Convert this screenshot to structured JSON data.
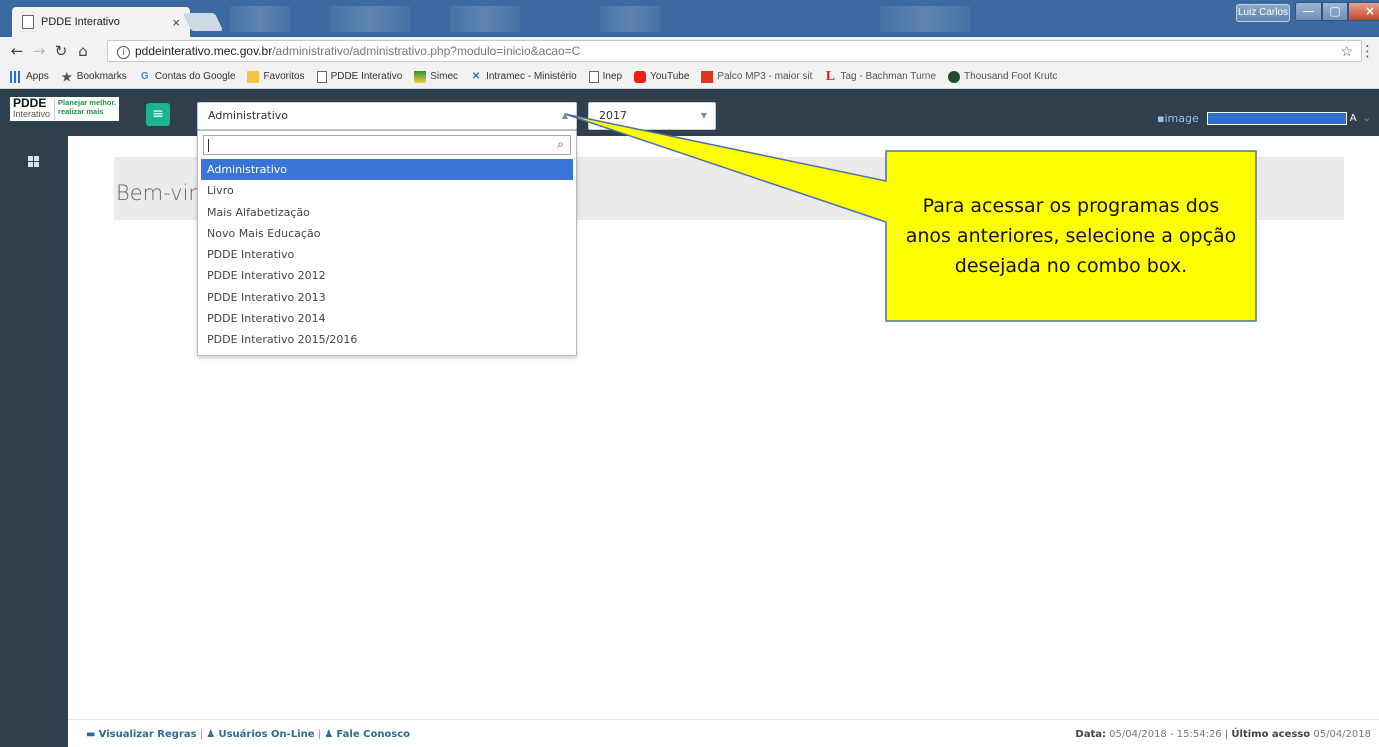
{
  "browser": {
    "tab_title": "PDDE Interativo",
    "tab_close": "×",
    "window_user": "Luiz Carlos",
    "window_buttons": {
      "minimize": "—",
      "maximize": "▢",
      "close": "×"
    },
    "url_host": "pddeinterativo.mec.gov.br",
    "url_path": "/administrativo/administrativo.php?modulo=inicio&acao=C",
    "bookmarks": [
      {
        "label": "Apps",
        "icon": "apps-grid-icon"
      },
      {
        "label": "Bookmarks",
        "icon": "star-icon"
      },
      {
        "label": "Contas do Google",
        "icon": "google-icon"
      },
      {
        "label": "Favoritos",
        "icon": "folder-icon"
      },
      {
        "label": "PDDE Interativo",
        "icon": "page-icon"
      },
      {
        "label": "Simec",
        "icon": "flag-icon"
      },
      {
        "label": "Intramec - Ministério",
        "icon": "x-icon"
      },
      {
        "label": "Inep",
        "icon": "page-icon"
      },
      {
        "label": "YouTube",
        "icon": "youtube-icon"
      },
      {
        "label": "Palco MP3 - maior sit",
        "icon": "palco-mp3-icon"
      },
      {
        "label": "Tag - Bachman Turne",
        "icon": "l-letter-icon"
      },
      {
        "label": "Thousand Foot Krutc",
        "icon": "globe-icon"
      }
    ]
  },
  "app": {
    "logo_title": "PDDE",
    "logo_sub": "Interativo",
    "logo_slogan_1": "Planejar melhor.",
    "logo_slogan_2": "realizar mais",
    "program_select_value": "Administrativo",
    "year_select_value": "2017",
    "user_image_alt": "image",
    "user_suffix": "A",
    "welcome": "Bem-vindo"
  },
  "dropdown": {
    "search_value": "",
    "options": [
      "Administrativo",
      "Livro",
      "Mais Alfabetização",
      "Novo Mais Educação",
      "PDDE Interativo",
      "PDDE Interativo 2012",
      "PDDE Interativo 2013",
      "PDDE Interativo 2014",
      "PDDE Interativo 2015/2016"
    ],
    "selected": "Administrativo"
  },
  "callout": {
    "text": "Para acessar os programas dos anos anteriores, selecione a opção desejada no combo box.",
    "color": "#ffff00",
    "border_color": "#4a72a8"
  },
  "footer": {
    "link_rules": "Visualizar Regras",
    "link_online": "Usuários On-Line",
    "link_contact": "Fale Conosco",
    "date_label": "Data:",
    "date_value": "05/04/2018 - 15:54:26",
    "last_access_label": "Último acesso",
    "last_access_value": "05/04/2018"
  }
}
